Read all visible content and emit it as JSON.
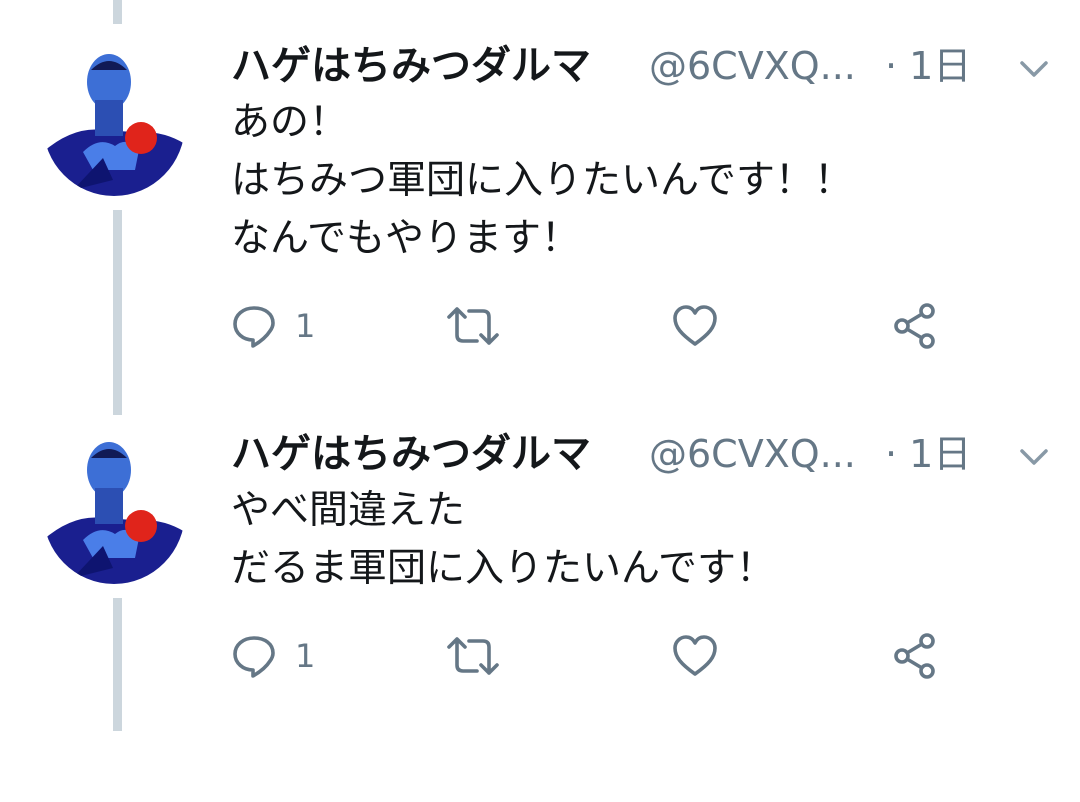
{
  "tweets": [
    {
      "display_name": "ハゲはちみつダルマ",
      "handle": "@6CVXQ...",
      "time": "· 1日",
      "body": [
        "あの！",
        "はちみつ軍団に入りたいんです！！",
        "なんでもやります！"
      ],
      "reply_count": "1",
      "avatar_text": "ハゲだるま"
    },
    {
      "display_name": "ハゲはちみつダルマ",
      "handle": "@6CVXQ...",
      "time": "· 1日",
      "body": [
        "やべ間違えた",
        "だるま軍団に入りたいんです！"
      ],
      "reply_count": "1",
      "avatar_text": "ハゲだるま"
    }
  ],
  "icons": {
    "reply": "reply-icon",
    "retweet": "retweet-icon",
    "like": "heart-icon",
    "share": "share-icon",
    "caret": "chevron-down-icon"
  },
  "colors": {
    "icon": "#657786",
    "thread_line": "#ccd6dd",
    "avatar_blue": "#1a1f8f",
    "avatar_red": "#e0241b"
  }
}
